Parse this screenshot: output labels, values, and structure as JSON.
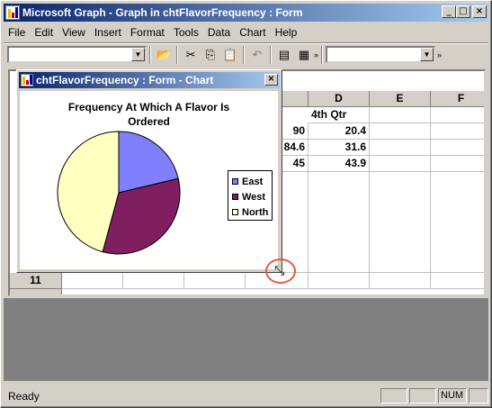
{
  "window": {
    "title": "Microsoft Graph - Graph in chtFlavorFrequency : Form"
  },
  "menu": [
    "File",
    "Edit",
    "View",
    "Insert",
    "Format",
    "Tools",
    "Data",
    "Chart",
    "Help"
  ],
  "toolbar": {
    "icons": [
      "folder-open-icon",
      "cut-icon",
      "copy-icon",
      "paste-icon",
      "undo-icon",
      "by-row-icon",
      "datasheet-icon"
    ]
  },
  "sheet": {
    "columns": [
      "D",
      "E",
      "F"
    ],
    "header_row": {
      "d": "4th Qtr"
    },
    "rows": [
      {
        "c": "90",
        "d": "20.4"
      },
      {
        "c": "84.6",
        "d": "31.6"
      },
      {
        "c": "45",
        "d": "43.9"
      }
    ],
    "row11_label": "11"
  },
  "chart_window": {
    "title": "chtFlavorFrequency : Form - Chart",
    "close": "×"
  },
  "chart_data": {
    "type": "pie",
    "title": "Frequency At Which A Flavor Is Ordered",
    "title_line1": "Frequency At Which A Flavor Is",
    "title_line2": "Ordered",
    "categories": [
      "East",
      "West",
      "North"
    ],
    "values": [
      20.4,
      31.6,
      43.9
    ],
    "colors": [
      "#8080ff",
      "#7f1f5f",
      "#ffffc0"
    ],
    "legend_position": "right"
  },
  "status": {
    "text": "Ready",
    "num": "NUM"
  }
}
